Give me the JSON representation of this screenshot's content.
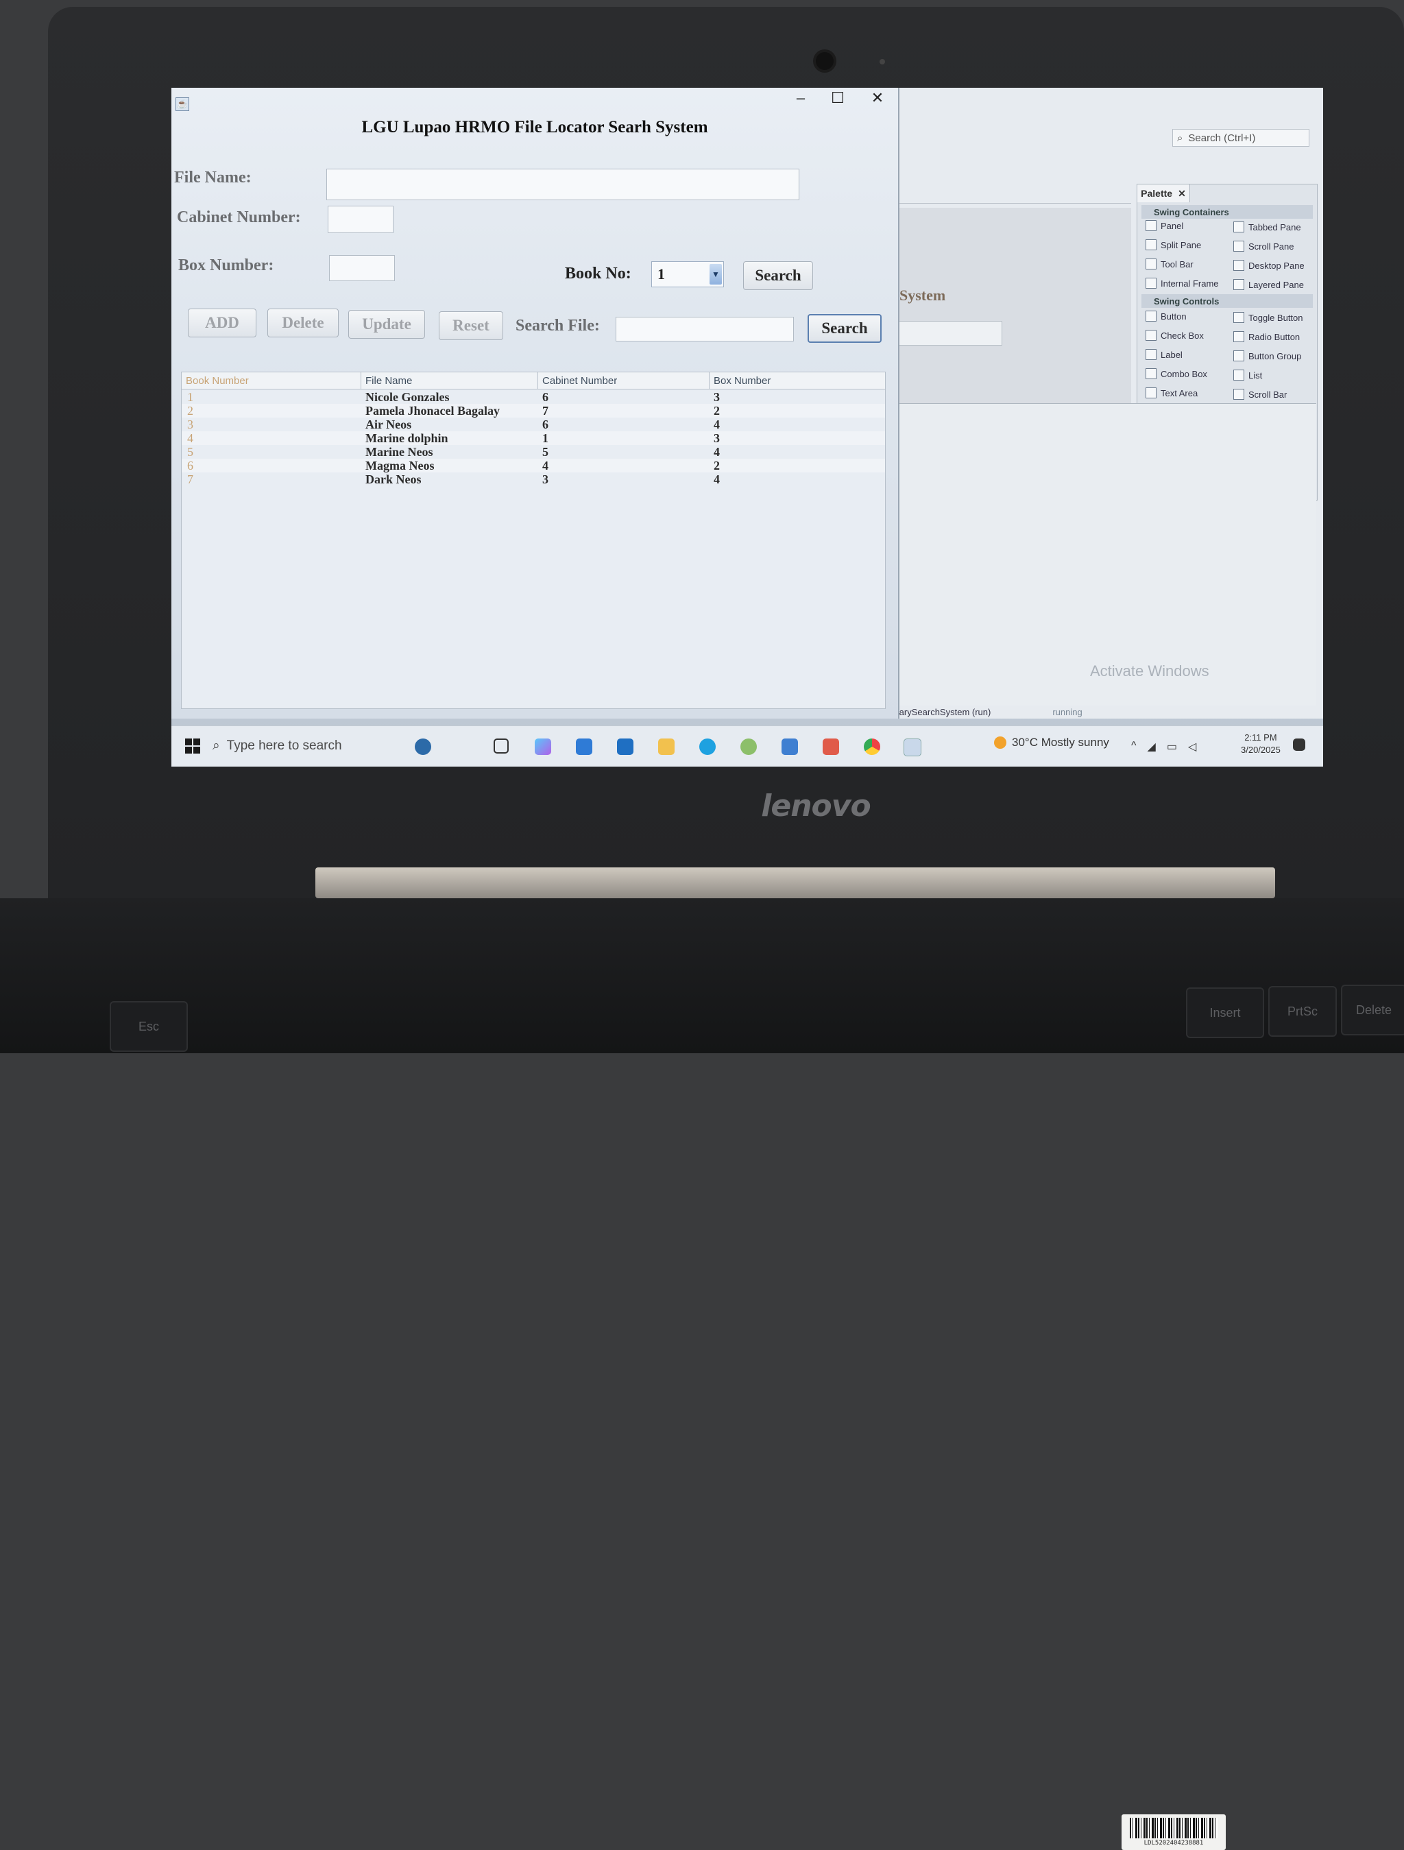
{
  "app": {
    "title": "LGU Lupao HRMO File Locator Searh System",
    "window_controls": {
      "minimize": "–",
      "maximize": "☐",
      "close": "✕"
    },
    "labels": {
      "file_name": "File Name:",
      "cabinet_number": "Cabinet Number:",
      "box_number": "Box Number:",
      "book_no": "Book No:",
      "search_file": "Search File:"
    },
    "fields": {
      "file_name": "",
      "cabinet_number": "",
      "box_number": "",
      "search_file": ""
    },
    "book_no_selected": "1",
    "buttons": {
      "search_book": "Search",
      "add": "ADD",
      "delete": "Delete",
      "update": "Update",
      "reset": "Reset",
      "search_file": "Search"
    },
    "table": {
      "columns": [
        "Book Number",
        "File Name",
        "Cabinet Number",
        "Box Number"
      ],
      "rows": [
        [
          "1",
          "Nicole Gonzales",
          "6",
          "3"
        ],
        [
          "2",
          "Pamela Jhonacel Bagalay",
          "7",
          "2"
        ],
        [
          "3",
          "Air Neos",
          "6",
          "4"
        ],
        [
          "4",
          "Marine dolphin",
          "1",
          "3"
        ],
        [
          "5",
          "Marine Neos",
          "5",
          "4"
        ],
        [
          "6",
          "Magma Neos",
          "4",
          "2"
        ],
        [
          "7",
          "Dark Neos",
          "3",
          "4"
        ]
      ]
    }
  },
  "ide": {
    "search_placeholder": "Search (Ctrl+I)",
    "background_word": "System",
    "palette": {
      "tab": "Palette",
      "categories": [
        "Swing Containers",
        "Swing Controls"
      ],
      "containers": [
        "Panel",
        "Tabbed Pane",
        "Split Pane",
        "Scroll Pane",
        "Tool Bar",
        "Desktop Pane",
        "Internal Frame",
        "Layered Pane"
      ],
      "controls": [
        "Button",
        "Toggle Button",
        "Check Box",
        "Radio Button",
        "Label",
        "Button Group",
        "Combo Box",
        "List",
        "Text Area",
        "Scroll Bar"
      ]
    },
    "status": {
      "project": "LibrarySearchSystem (run)",
      "state": "running"
    },
    "watermark": "Activate Windows"
  },
  "taskbar": {
    "search_placeholder": "Type here to search",
    "weather": "30°C  Mostly sunny",
    "time": "2:11 PM",
    "date": "3/20/2025"
  },
  "laptop": {
    "brand": "lenovo",
    "keys": [
      "Esc",
      "Insert",
      "PrtSc",
      "Delete"
    ]
  },
  "colors": {
    "accent": "#5a7fb0",
    "app_bg": "#dfe6ee",
    "bezel": "#2b2c2e"
  }
}
